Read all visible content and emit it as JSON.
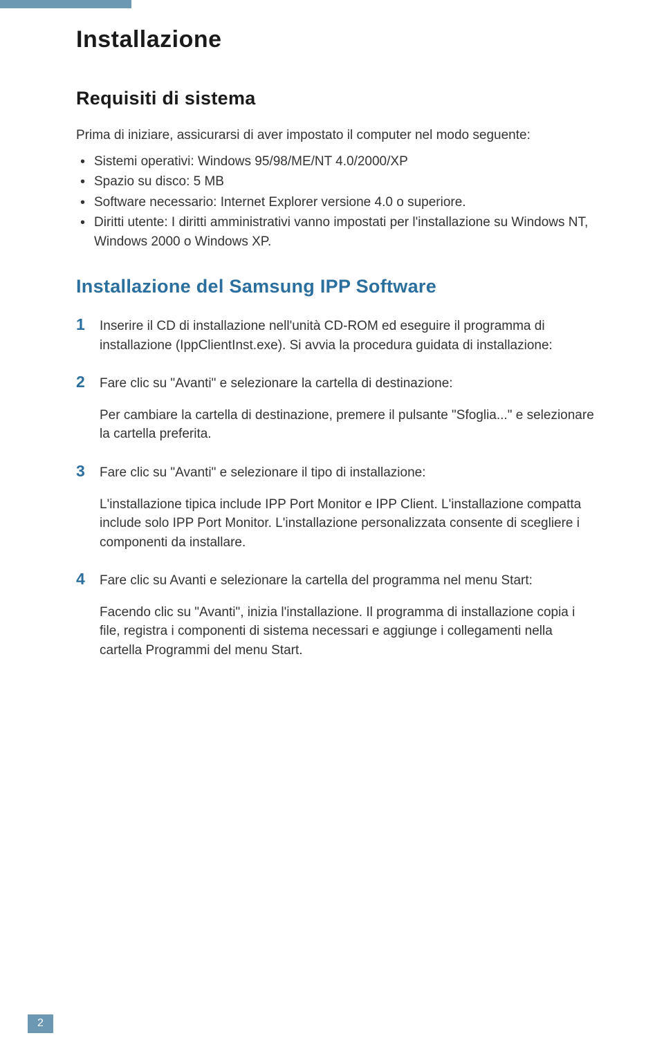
{
  "page": {
    "title": "Installazione",
    "section1_heading": "Requisiti di sistema",
    "intro": "Prima di iniziare, assicurarsi di aver impostato il computer nel modo seguente:",
    "requirements": [
      "Sistemi operativi: Windows 95/98/ME/NT 4.0/2000/XP",
      "Spazio su disco: 5 MB",
      "Software necessario: Internet Explorer versione 4.0 o superiore.",
      "Diritti utente: I diritti amministrativi vanno impostati per l'installazione su Windows NT, Windows 2000 o Windows XP."
    ],
    "section2_heading": "Installazione del Samsung IPP Software",
    "steps": [
      {
        "main": "Inserire il CD di installazione nell'unità CD-ROM ed eseguire il programma di installazione (IppClientInst.exe). Si avvia la procedura guidata di installazione:"
      },
      {
        "main": "Fare clic su \"Avanti\" e selezionare la cartella di destinazione:",
        "sub": "Per cambiare la cartella di destinazione, premere il pulsante \"Sfoglia...\" e selezionare la cartella preferita."
      },
      {
        "main": "Fare clic su \"Avanti\" e selezionare il tipo di installazione:",
        "sub": "L'installazione tipica include IPP Port Monitor e IPP Client. L'installazione compatta include solo IPP Port Monitor. L'installazione personalizzata consente di scegliere i componenti da installare."
      },
      {
        "main": "Fare clic su Avanti e selezionare la cartella del programma nel menu Start:",
        "sub": "Facendo clic su \"Avanti\", inizia l'installazione. Il programma di installazione copia i file, registra i componenti di sistema necessari e aggiunge i collegamenti nella cartella Programmi del menu Start."
      }
    ],
    "page_number": "2"
  }
}
